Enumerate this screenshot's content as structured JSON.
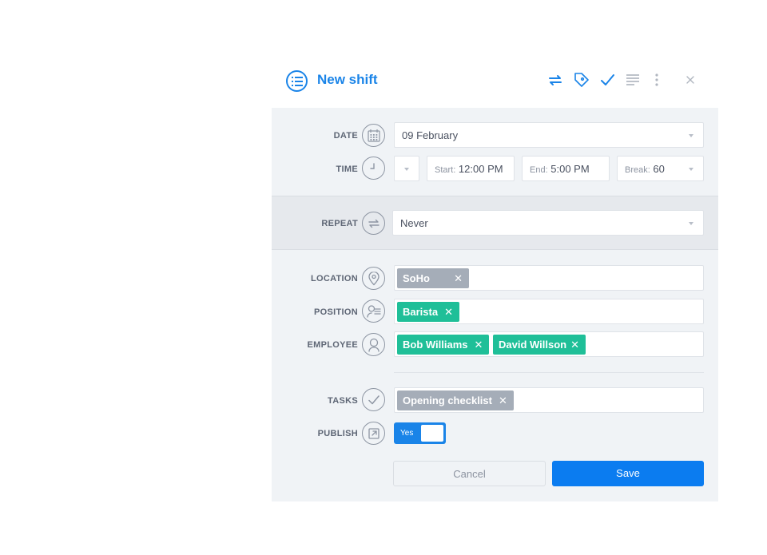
{
  "header": {
    "title": "New shift",
    "icons": [
      "list-circle-icon",
      "repeat-icon",
      "tag-icon",
      "check-icon",
      "notes-icon",
      "more-vertical-icon",
      "close-icon"
    ]
  },
  "form": {
    "date": {
      "label": "DATE",
      "value": "09 February",
      "icon": "calendar-icon"
    },
    "time": {
      "label": "TIME",
      "icon": "clock-icon",
      "start_label": "Start:",
      "start_value": "12:00 PM",
      "end_label": "End:",
      "end_value": "5:00 PM",
      "break_label": "Break:",
      "break_value": "60"
    },
    "repeat": {
      "label": "REPEAT",
      "value": "Never",
      "icon": "repeat-icon"
    },
    "location": {
      "label": "LOCATION",
      "icon": "map-pin-icon",
      "tags": [
        "SoHo"
      ]
    },
    "position": {
      "label": "POSITION",
      "icon": "position-icon",
      "tags": [
        "Barista"
      ]
    },
    "employee": {
      "label": "EMPLOYEE",
      "icon": "user-icon",
      "tags": [
        "Bob Williams",
        "David Willson"
      ]
    },
    "tasks": {
      "label": "TASKS",
      "icon": "check-circle-icon",
      "tags": [
        "Opening checklist"
      ]
    },
    "publish": {
      "label": "PUBLISH",
      "icon": "external-link-icon",
      "toggle_text": "Yes",
      "enabled": true
    }
  },
  "actions": {
    "cancel_label": "Cancel",
    "save_label": "Save"
  },
  "colors": {
    "accent": "#1a84e8",
    "tag_green": "#1fbf98",
    "tag_gray": "#a5adb8",
    "save": "#0b7cf0"
  },
  "tag_close_glyph": "✕"
}
